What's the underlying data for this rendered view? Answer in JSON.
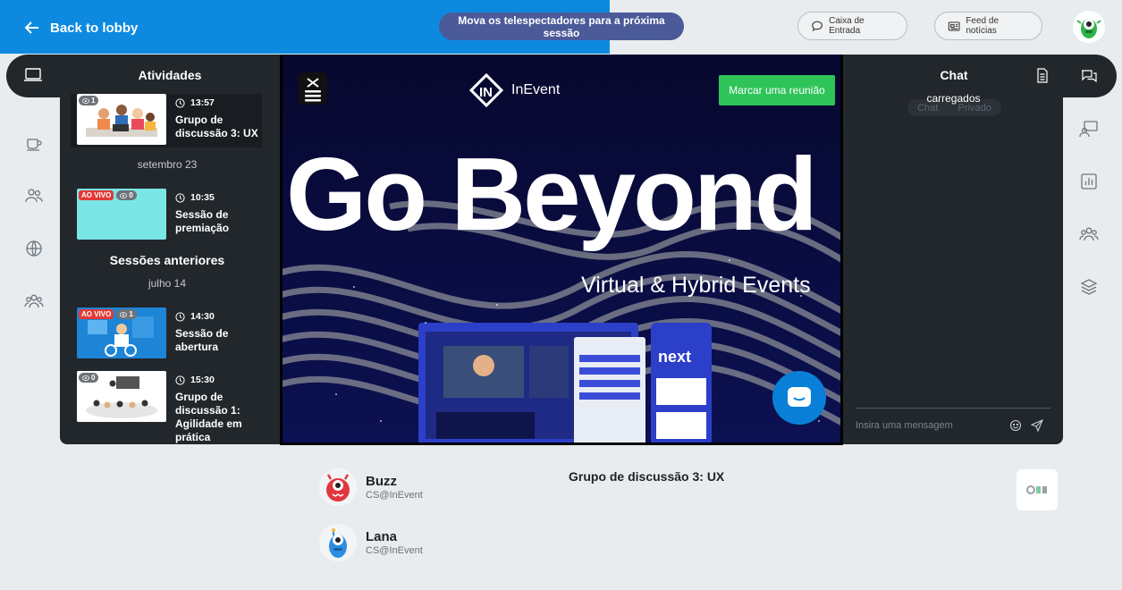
{
  "topbar": {
    "back_label": "Back to lobby",
    "move_viewers_label": "Mova os telespectadores para a próxima sessão",
    "inbox_label": "Caixa de Entrada",
    "news_label": "Feed de notícias"
  },
  "activities": {
    "title": "Atividades",
    "sessions": [
      {
        "time": "13:57",
        "title": "Grupo de discussão 3: UX",
        "viewers": "1",
        "live": "",
        "selected": true
      },
      {
        "time": "10:35",
        "title": "Sessão de premiação",
        "viewers": "0",
        "live": "AO VIVO"
      },
      {
        "time": "14:30",
        "title": "Sessão de abertura",
        "viewers": "1",
        "live": "AO VIVO"
      },
      {
        "time": "15:30",
        "title": "Grupo de discussão 1: Agilidade em prática",
        "viewers": "0",
        "live": ""
      }
    ],
    "date_1": "setembro 23",
    "past_title": "Sessões anteriores",
    "date_2": "julho 14"
  },
  "video": {
    "brand": "InEvent",
    "meet_label": "Marcar uma reunião",
    "headline": "Go Beyond",
    "subline": "Virtual & Hybrid Events"
  },
  "chat": {
    "title": "Chat",
    "loaded": "carregados",
    "tab_chat": "Chat",
    "tab_private": "Privado",
    "input_placeholder": "Insira uma mensagem"
  },
  "below": {
    "session_title": "Grupo de discussão 3: UX",
    "speakers": [
      {
        "name": "Buzz",
        "org": "CS@InEvent"
      },
      {
        "name": "Lana",
        "org": "CS@InEvent"
      }
    ]
  },
  "colors": {
    "accent_blue": "#0d8ae0",
    "dark": "#22272c",
    "green": "#2ec45a",
    "live_red": "#e53935"
  }
}
